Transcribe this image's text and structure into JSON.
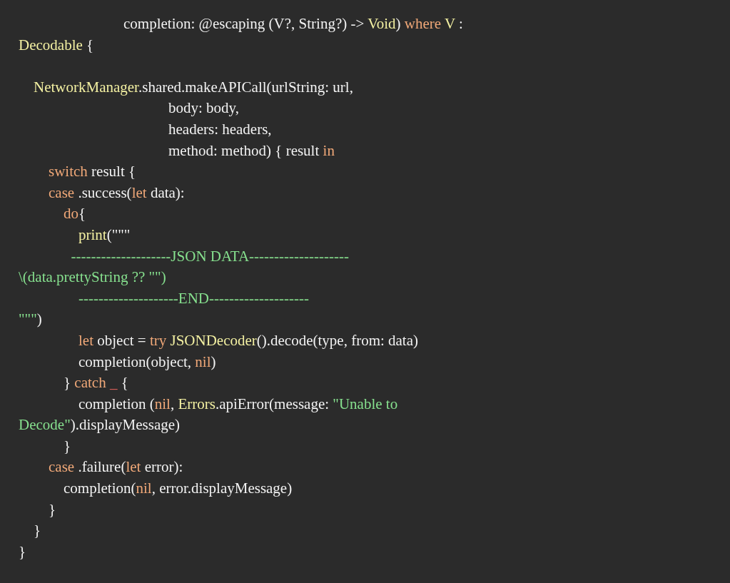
{
  "code_lines": [
    {
      "kind": "code",
      "tokens": [
        {
          "text": "                            completion: @escaping (V?, String?) -> ",
          "kind": "plain"
        },
        {
          "text": "Void",
          "kind": "type"
        },
        {
          "text": ") ",
          "kind": "plain"
        },
        {
          "text": "where",
          "kind": "keyword"
        },
        {
          "text": " V",
          "kind": "type"
        },
        {
          "text": " :",
          "kind": "plain"
        }
      ]
    },
    {
      "kind": "code",
      "tokens": [
        {
          "text": "Decodable",
          "kind": "type"
        },
        {
          "text": " {",
          "kind": "plain"
        }
      ]
    },
    {
      "kind": "blank"
    },
    {
      "kind": "code",
      "tokens": [
        {
          "text": "    NetworkManager",
          "kind": "type"
        },
        {
          "text": ".shared.makeAPICall(urlString: url,",
          "kind": "plain"
        }
      ]
    },
    {
      "kind": "code",
      "tokens": [
        {
          "text": "                                        body: body,",
          "kind": "plain"
        }
      ]
    },
    {
      "kind": "code",
      "tokens": [
        {
          "text": "                                        headers: headers,",
          "kind": "plain"
        }
      ]
    },
    {
      "kind": "code",
      "tokens": [
        {
          "text": "                                        method: method) { result ",
          "kind": "plain"
        },
        {
          "text": "in",
          "kind": "keyword"
        }
      ]
    },
    {
      "kind": "code",
      "tokens": [
        {
          "text": "        switch",
          "kind": "keyword"
        },
        {
          "text": " result {",
          "kind": "plain"
        }
      ]
    },
    {
      "kind": "code",
      "tokens": [
        {
          "text": "        case",
          "kind": "keyword"
        },
        {
          "text": " .success(",
          "kind": "plain"
        },
        {
          "text": "let",
          "kind": "keyword"
        },
        {
          "text": " data):",
          "kind": "plain"
        }
      ]
    },
    {
      "kind": "code",
      "tokens": [
        {
          "text": "            do",
          "kind": "keyword"
        },
        {
          "text": "{",
          "kind": "plain"
        }
      ]
    },
    {
      "kind": "code",
      "tokens": [
        {
          "text": "                print",
          "kind": "type"
        },
        {
          "text": "(\"\"\"",
          "kind": "plain"
        }
      ]
    },
    {
      "kind": "code",
      "tokens": [
        {
          "text": "              --------------------JSON DATA--------------------",
          "kind": "string"
        }
      ]
    },
    {
      "kind": "code",
      "tokens": [
        {
          "text": "\\(data.prettyString ?? \"\")",
          "kind": "string"
        }
      ]
    },
    {
      "kind": "code",
      "tokens": [
        {
          "text": "                --------------------END--------------------",
          "kind": "string"
        }
      ]
    },
    {
      "kind": "code",
      "tokens": [
        {
          "text": "\"\"\"",
          "kind": "string"
        },
        {
          "text": ")",
          "kind": "plain"
        }
      ]
    },
    {
      "kind": "code",
      "tokens": [
        {
          "text": "                let",
          "kind": "keyword"
        },
        {
          "text": " object = ",
          "kind": "plain"
        },
        {
          "text": "try",
          "kind": "keyword"
        },
        {
          "text": " JSONDecoder",
          "kind": "type"
        },
        {
          "text": "().decode(type, from: data)",
          "kind": "plain"
        }
      ]
    },
    {
      "kind": "code",
      "tokens": [
        {
          "text": "                completion(object, ",
          "kind": "plain"
        },
        {
          "text": "nil",
          "kind": "keyword"
        },
        {
          "text": ")",
          "kind": "plain"
        }
      ]
    },
    {
      "kind": "code",
      "tokens": [
        {
          "text": "            } ",
          "kind": "plain"
        },
        {
          "text": "catch ",
          "kind": "keyword"
        },
        {
          "text": "_",
          "kind": "error"
        },
        {
          "text": " {",
          "kind": "plain"
        }
      ]
    },
    {
      "kind": "code",
      "tokens": [
        {
          "text": "                completion (",
          "kind": "plain"
        },
        {
          "text": "nil",
          "kind": "keyword"
        },
        {
          "text": ", ",
          "kind": "plain"
        },
        {
          "text": "Errors",
          "kind": "type"
        },
        {
          "text": ".apiError(message: ",
          "kind": "plain"
        },
        {
          "text": "\"Unable to",
          "kind": "string"
        }
      ]
    },
    {
      "kind": "code",
      "tokens": [
        {
          "text": "Decode\"",
          "kind": "string"
        },
        {
          "text": ").displayMessage)",
          "kind": "plain"
        }
      ]
    },
    {
      "kind": "code",
      "tokens": [
        {
          "text": "            }",
          "kind": "plain"
        }
      ]
    },
    {
      "kind": "code",
      "tokens": [
        {
          "text": "        case",
          "kind": "keyword"
        },
        {
          "text": " .failure(",
          "kind": "plain"
        },
        {
          "text": "let",
          "kind": "keyword"
        },
        {
          "text": " error):",
          "kind": "plain"
        }
      ]
    },
    {
      "kind": "code",
      "tokens": [
        {
          "text": "            completion(",
          "kind": "plain"
        },
        {
          "text": "nil",
          "kind": "keyword"
        },
        {
          "text": ", error.displayMessage)",
          "kind": "plain"
        }
      ]
    },
    {
      "kind": "code",
      "tokens": [
        {
          "text": "        }",
          "kind": "plain"
        }
      ]
    },
    {
      "kind": "code",
      "tokens": [
        {
          "text": "    }",
          "kind": "plain"
        }
      ]
    },
    {
      "kind": "code",
      "tokens": [
        {
          "text": "}",
          "kind": "plain"
        }
      ]
    }
  ]
}
